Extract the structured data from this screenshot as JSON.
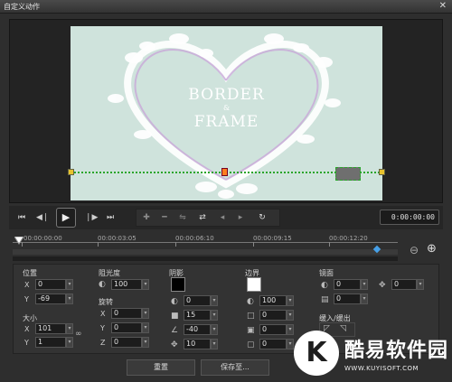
{
  "window": {
    "title": "自定义动作",
    "close_glyph": "✕"
  },
  "preview": {
    "title_line1": "BORDER",
    "title_amp": "&",
    "title_line2": "FRAME"
  },
  "controls": {
    "timecode": "0:00:00:00",
    "icons": [
      "skip-start-icon",
      "prev-frame-icon",
      "play-icon",
      "next-frame-icon",
      "skip-end-icon"
    ],
    "tools": [
      "add-keyframe-icon",
      "remove-keyframe-icon",
      "reverse-icon",
      "swap-icon",
      "move-left-icon",
      "move-right-icon",
      "reset-icon"
    ]
  },
  "timeline": {
    "ticks": [
      "00:00:00:00",
      "00:00:03:05",
      "00:00:06:10",
      "00:00:09:15",
      "00:00:12:20"
    ]
  },
  "properties": {
    "position": {
      "title": "位置",
      "x_label": "X",
      "x_value": "0",
      "y_label": "Y",
      "y_value": "-69"
    },
    "size": {
      "title": "大小",
      "x_label": "X",
      "x_value": "101",
      "y_label": "Y",
      "y_value": "1"
    },
    "opacity": {
      "title": "阻光度",
      "value": "100"
    },
    "rotation": {
      "title": "旋转",
      "x_label": "X",
      "x_value": "0",
      "y_label": "Y",
      "y_value": "0",
      "z_label": "Z",
      "z_value": "0"
    },
    "shadow": {
      "title": "阴影",
      "color": "#000000",
      "opacity": "0",
      "blur": "15",
      "angle": "-40",
      "distance": "10"
    },
    "border": {
      "title": "边界",
      "color": "#ffffff",
      "opacity": "100",
      "width": "0",
      "blur": "0",
      "shape": "0"
    },
    "mirror": {
      "title": "镜面",
      "opacity": "0",
      "value2": "0",
      "value3": "0",
      "offset": "0"
    },
    "fade": {
      "title": "缓入/缓出"
    }
  },
  "footer": {
    "reset_label": "重置",
    "save_label": "保存至..."
  },
  "watermark": {
    "logo_letter": "K",
    "title": "酷易软件园",
    "url": "WWW.KUYISOFT.COM"
  },
  "colors": {
    "accent_path": "#2aa52a",
    "keyframe": "#e8c22d",
    "keyframe_active": "#ff7d20",
    "preview_bg": "#cfe3dc"
  }
}
